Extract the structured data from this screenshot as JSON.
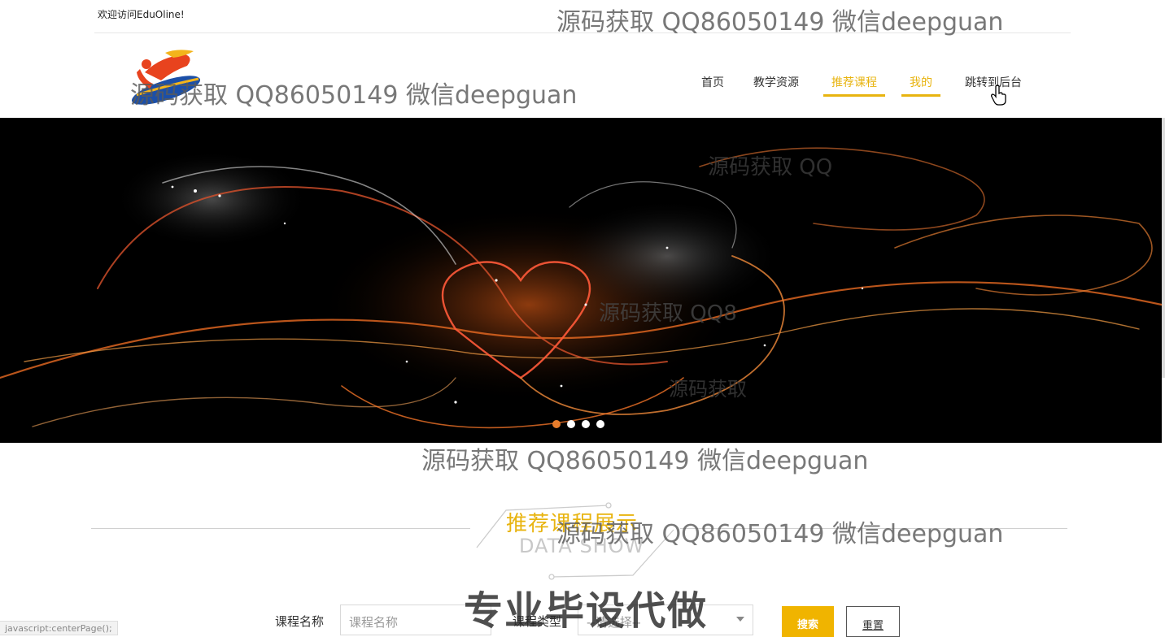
{
  "topbar": {
    "welcome": "欢迎访问EduOline!"
  },
  "header": {
    "nav": [
      {
        "label": "首页",
        "active": false
      },
      {
        "label": "教学资源",
        "active": false
      },
      {
        "label": "推荐课程",
        "active": true
      },
      {
        "label": "我的",
        "active": true
      },
      {
        "label": "跳转到后台",
        "active": false
      }
    ]
  },
  "banner": {
    "slides_count": 4,
    "active_slide": 1
  },
  "section": {
    "title": "推荐课程展示",
    "subtitle": "DATA SHOW"
  },
  "search": {
    "course_name_label": "课程名称",
    "course_name_placeholder": "课程名称",
    "course_type_label": "课程类型",
    "course_type_selected": "--请选择--",
    "search_button": "搜索",
    "reset_button": "重置"
  },
  "watermarks": {
    "source_text": "源码获取 QQ86050149 微信deepguan",
    "fragment_1": "源码获取 QQ",
    "fragment_2": "源码获取 QQ8",
    "fragment_3": "源码获取",
    "big_text": "专业毕设代做"
  },
  "statusbar": {
    "text": "javascript:centerPage();"
  },
  "colors": {
    "accent": "#e8b410",
    "search_button": "#f0b400",
    "dot_active": "#e87d2c"
  }
}
